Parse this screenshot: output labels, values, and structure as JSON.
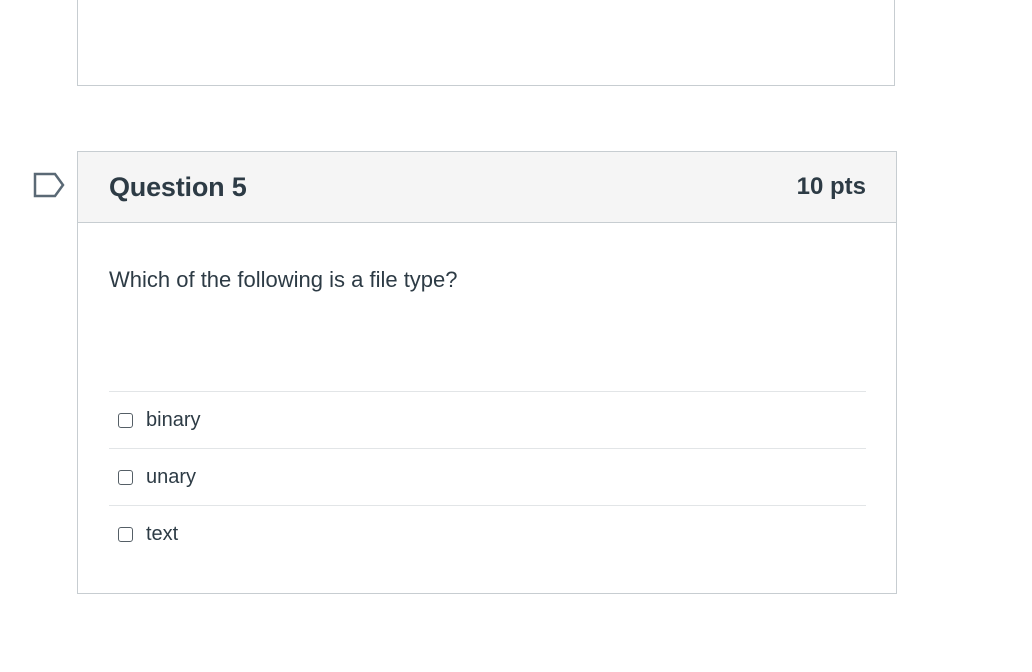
{
  "question": {
    "title": "Question 5",
    "points": "10 pts",
    "text": "Which of the following is a file type?",
    "answers": [
      {
        "label": "binary",
        "checked": false
      },
      {
        "label": "unary",
        "checked": false
      },
      {
        "label": "text",
        "checked": false
      }
    ]
  },
  "colors": {
    "border": "#c7cdd1",
    "header_bg": "#f5f5f5",
    "text": "#2d3b45",
    "flag": "#5a6975"
  }
}
